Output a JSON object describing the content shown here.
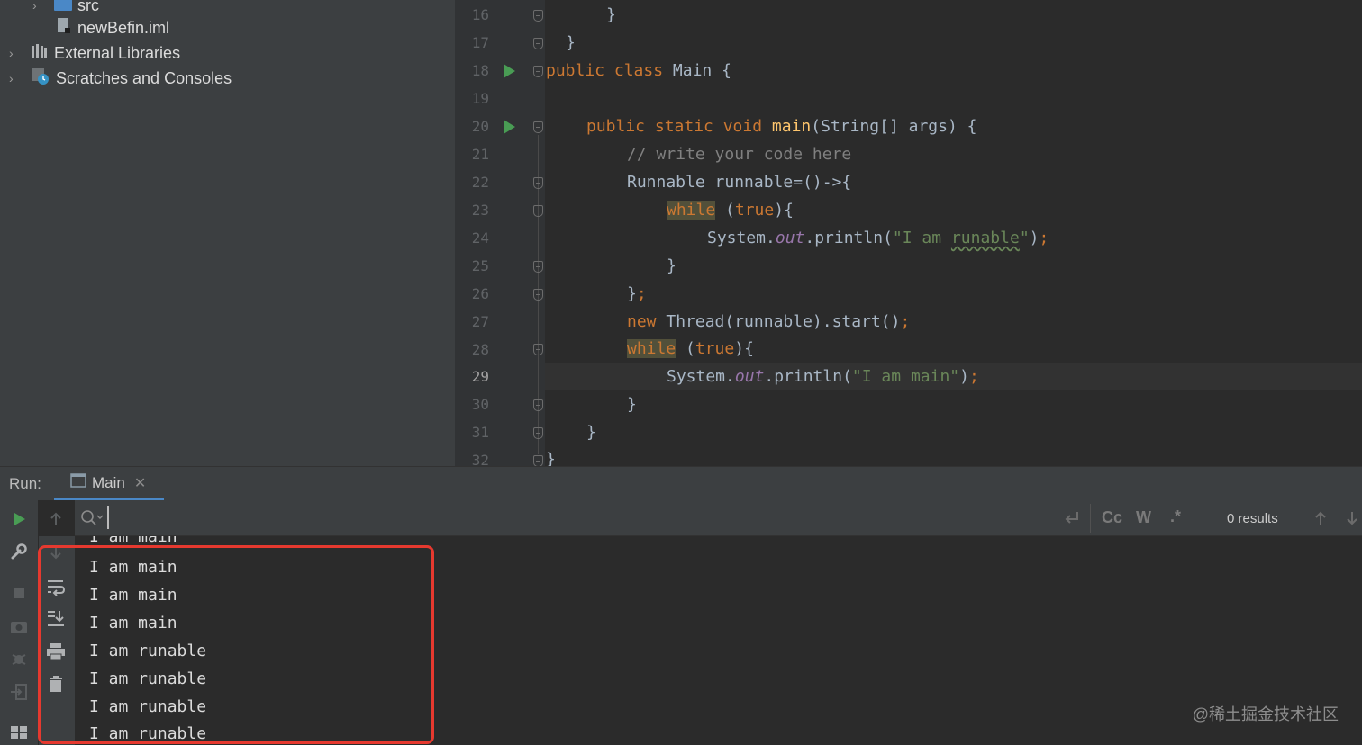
{
  "project_tree": {
    "items": [
      {
        "label": "src",
        "icon": "folder-icon"
      },
      {
        "label": "newBefin.iml",
        "icon": "iml-file-icon"
      },
      {
        "label": "External Libraries",
        "icon": "libraries-icon"
      },
      {
        "label": "Scratches and Consoles",
        "icon": "scratches-icon"
      }
    ]
  },
  "editor": {
    "line_numbers": [
      "16",
      "17",
      "18",
      "19",
      "20",
      "21",
      "22",
      "23",
      "24",
      "25",
      "26",
      "27",
      "28",
      "29",
      "30",
      "31",
      "32"
    ],
    "current_line": "29",
    "lines": {
      "l16": "}",
      "l17": "}",
      "l18_kw": "public class ",
      "l18_rest": "Main {",
      "l20_kw": "public static void ",
      "l20_fn": "main",
      "l20_rest": "(String[] args) {",
      "l21": "// write your code here",
      "l22": "Runnable runnable=()->{",
      "l23_kw": "while",
      "l23_sp": " (",
      "l23_true": "true",
      "l23_rest": "){",
      "l24_a": "System.",
      "l24_out": "out",
      "l24_b": ".println(",
      "l24_s1": "\"I am ",
      "l24_s2": "runable",
      "l24_s3": "\"",
      "l24_c": ")",
      "l24_semi": ";",
      "l25": "}",
      "l26_a": "}",
      "l26_semi": ";",
      "l27_new": "new ",
      "l27_rest": "Thread(runnable).start()",
      "l27_semi": ";",
      "l28_kw": "while",
      "l28_sp": " (",
      "l28_true": "true",
      "l28_rest": "){",
      "l29_a": "System.",
      "l29_out": "out",
      "l29_b": ".println(",
      "l29_s": "\"I am main\"",
      "l29_c": ")",
      "l29_semi": ";",
      "l30": "}",
      "l31": "}",
      "l32": "}"
    }
  },
  "run_panel": {
    "label": "Run:",
    "tab_label": "Main",
    "search": {
      "value": "",
      "results": "0 results",
      "match_case": "Cc",
      "words": "W",
      "regex": ".*"
    },
    "output": [
      "I am main",
      "I am main",
      "I am main",
      "I am main",
      "I am runable",
      "I am runable",
      "I am runable",
      "I am runable"
    ]
  },
  "watermark": "@稀土掘金技术社区",
  "colors": {
    "keyword": "#cc7832",
    "string": "#6a8759",
    "function": "#ffc66d",
    "annotation_box": "#e6392f",
    "run_green": "#499c54"
  }
}
